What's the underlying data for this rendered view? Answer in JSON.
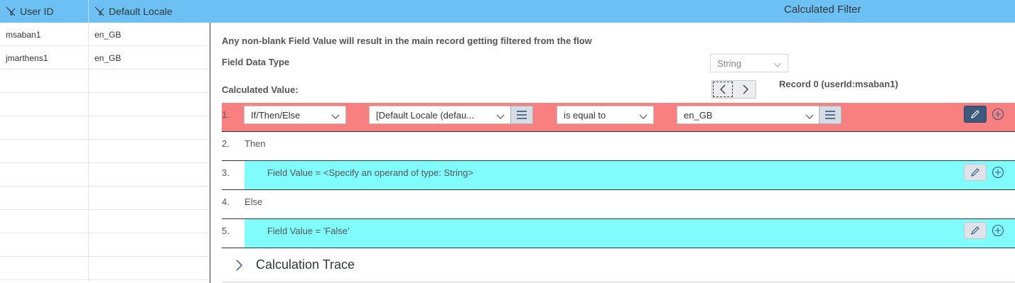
{
  "header": {
    "columns": [
      {
        "label": "User ID",
        "icon": "filter-off-icon"
      },
      {
        "label": "Default Locale",
        "icon": "filter-off-icon"
      }
    ],
    "panel_title": "Calculated Filter"
  },
  "grid": {
    "rows": [
      {
        "user_id": "msaban1",
        "locale": "en_GB"
      },
      {
        "user_id": "jmarthens1",
        "locale": "en_GB"
      }
    ]
  },
  "filter": {
    "info": "Any non-blank Field Value will result in the main record getting filtered from the flow",
    "field_data_type_label": "Field Data Type",
    "field_data_type_value": "String",
    "calculated_value_label": "Calculated Value:",
    "record_label": "Record 0 (userId:msaban1)"
  },
  "lines": [
    {
      "num": "1.",
      "type": "If/Then/Else",
      "field": "[Default Locale (defau...",
      "operator": "is equal to",
      "value": "en_GB"
    },
    {
      "num": "2.",
      "text": "Then"
    },
    {
      "num": "3.",
      "text": "Field Value = <Specify an operand of type: String>"
    },
    {
      "num": "4.",
      "text": "Else"
    },
    {
      "num": "5.",
      "text": "Field Value = 'False'"
    }
  ],
  "trace": {
    "label": "Calculation Trace"
  },
  "colors": {
    "header_bg": "#6cc0f3",
    "condition_row_bg": "#f98080",
    "value_row_bg": "#80fcfd",
    "edit_active_bg": "#3c5a7d"
  }
}
